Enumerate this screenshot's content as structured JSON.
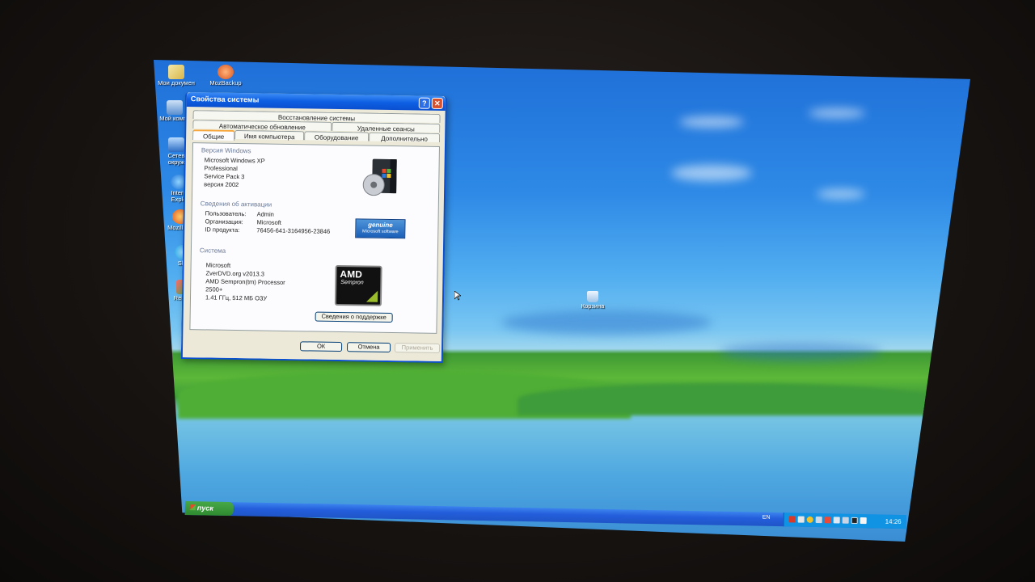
{
  "desktop": {
    "icons": [
      {
        "label": "Мои докумен",
        "icon": "my-documents-icon"
      },
      {
        "label": "MozBackup",
        "icon": "mozbackup-icon"
      },
      {
        "label": "Мой компь",
        "icon": "my-computer-icon"
      },
      {
        "label": "Сетев окруж",
        "icon": "network-places-icon"
      },
      {
        "label": "Intern Explo",
        "icon": "internet-explorer-icon"
      },
      {
        "label": "Mozilla Fi",
        "icon": "firefox-icon"
      },
      {
        "label": "Sky",
        "icon": "skype-icon"
      },
      {
        "label": "Recu wi",
        "icon": "app-icon"
      },
      {
        "label": "Корзина",
        "icon": "recycle-bin-icon"
      }
    ]
  },
  "dialog": {
    "title": "Свойства системы",
    "tabs_row1": [
      "Восстановление системы"
    ],
    "tabs_row2": [
      "Автоматическое обновление",
      "Удаленные сеансы"
    ],
    "tabs_row3": [
      "Общие",
      "Имя компьютера",
      "Оборудование",
      "Дополнительно"
    ],
    "active_tab": "Общие",
    "windows_version": {
      "label": "Версия Windows",
      "lines": [
        "Microsoft Windows XP",
        "Professional",
        "Service Pack 3",
        "версия 2002"
      ]
    },
    "activation": {
      "label": "Сведения об активации",
      "user_label": "Пользователь:",
      "user_value": "Admin",
      "org_label": "Организация:",
      "org_value": "Microsoft",
      "id_label": "ID продукта:",
      "id_value": "76456-641-3164956-23846"
    },
    "genuine_badge": {
      "text": "genuine",
      "sub": "Microsoft software"
    },
    "system": {
      "label": "Система",
      "lines": [
        "Microsoft",
        "ZverDVD.org v2013.3",
        "AMD Sempron(tm) Processor",
        "2500+",
        "1.41 ГГц, 512 МБ ОЗУ"
      ]
    },
    "amd_logo": {
      "brand": "AMD",
      "model": "Sempron"
    },
    "support_button": "Сведения о поддержке",
    "ok_button": "ОК",
    "cancel_button": "Отмена",
    "apply_button": "Применить"
  },
  "taskbar": {
    "start_label": "пуск",
    "language": "EN",
    "clock": "14:26"
  },
  "colors": {
    "title_bar": "#0a50d0",
    "dialog_bg": "#ece9d8",
    "taskbar": "#245edb",
    "start_green": "#3a983a"
  }
}
